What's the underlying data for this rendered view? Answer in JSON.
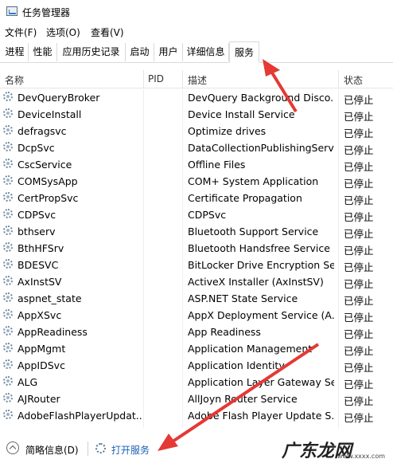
{
  "window": {
    "title": "任务管理器"
  },
  "menu": [
    "文件(F)",
    "选项(O)",
    "查看(V)"
  ],
  "tabs": [
    "进程",
    "性能",
    "应用历史记录",
    "启动",
    "用户",
    "详细信息",
    "服务"
  ],
  "active_tab": "服务",
  "columns": {
    "name": "名称",
    "pid": "PID",
    "desc": "描述",
    "status": "状态"
  },
  "services": [
    {
      "name": "DevQueryBroker",
      "desc": "DevQuery Background Disco...",
      "status": "已停止"
    },
    {
      "name": "DeviceInstall",
      "desc": "Device Install Service",
      "status": "已停止"
    },
    {
      "name": "defragsvc",
      "desc": "Optimize drives",
      "status": "已停止"
    },
    {
      "name": "DcpSvc",
      "desc": "DataCollectionPublishingServi...",
      "status": "已停止"
    },
    {
      "name": "CscService",
      "desc": "Offline Files",
      "status": "已停止"
    },
    {
      "name": "COMSysApp",
      "desc": "COM+ System Application",
      "status": "已停止"
    },
    {
      "name": "CertPropSvc",
      "desc": "Certificate Propagation",
      "status": "已停止"
    },
    {
      "name": "CDPSvc",
      "desc": "CDPSvc",
      "status": "已停止"
    },
    {
      "name": "bthserv",
      "desc": "Bluetooth Support Service",
      "status": "已停止"
    },
    {
      "name": "BthHFSrv",
      "desc": "Bluetooth Handsfree Service",
      "status": "已停止"
    },
    {
      "name": "BDESVC",
      "desc": "BitLocker Drive Encryption Se...",
      "status": "已停止"
    },
    {
      "name": "AxInstSV",
      "desc": "ActiveX Installer (AxInstSV)",
      "status": "已停止"
    },
    {
      "name": "aspnet_state",
      "desc": "ASP.NET State Service",
      "status": "已停止"
    },
    {
      "name": "AppXSvc",
      "desc": "AppX Deployment Service (A...",
      "status": "已停止"
    },
    {
      "name": "AppReadiness",
      "desc": "App Readiness",
      "status": "已停止"
    },
    {
      "name": "AppMgmt",
      "desc": "Application Management",
      "status": "已停止"
    },
    {
      "name": "AppIDSvc",
      "desc": "Application Identity",
      "status": "已停止"
    },
    {
      "name": "ALG",
      "desc": "Application Layer Gateway Se...",
      "status": "已停止"
    },
    {
      "name": "AJRouter",
      "desc": "AllJoyn Router Service",
      "status": "已停止"
    },
    {
      "name": "AdobeFlashPlayerUpdat...",
      "desc": "Adobe Flash Player Update S...",
      "status": "已停止"
    }
  ],
  "footer": {
    "brief": "简略信息(D)",
    "open_services": "打开服务"
  },
  "watermark": {
    "text": "广东龙网",
    "sub": "www.xxxx.com"
  },
  "colors": {
    "accent": "#1a5fb4",
    "arrow": "#e53935"
  }
}
